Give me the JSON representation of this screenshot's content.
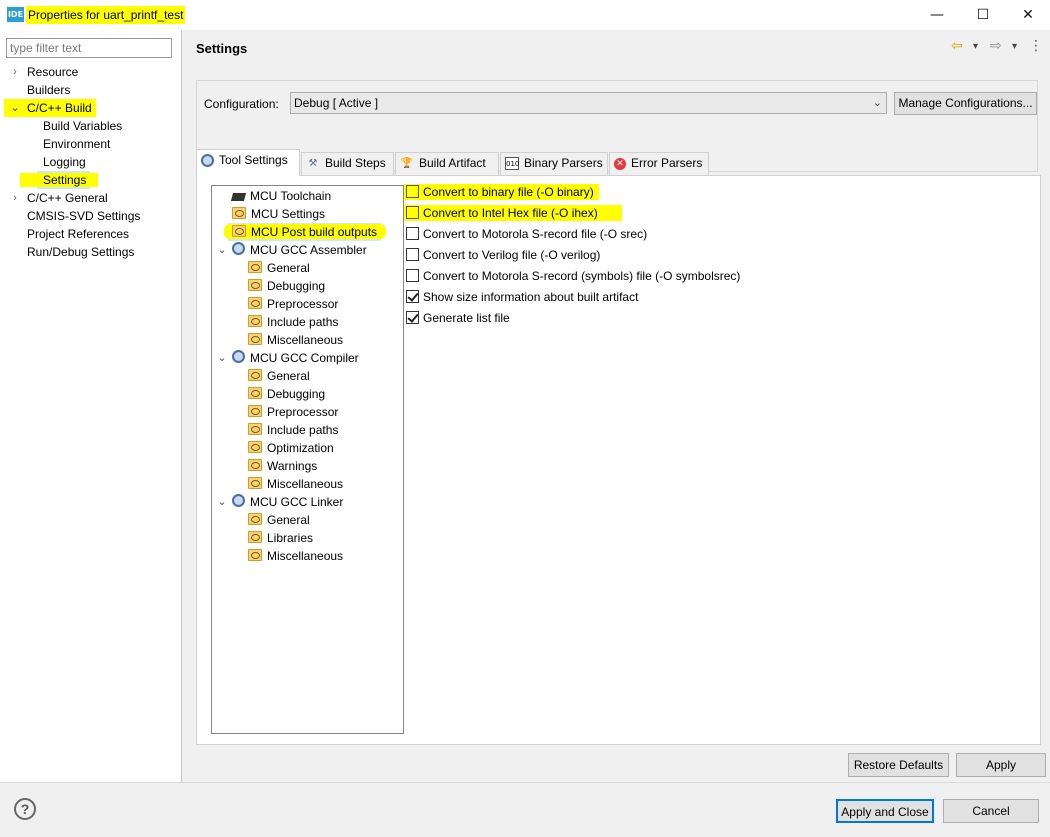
{
  "window": {
    "icon_label": "IDE",
    "title": "Properties for uart_printf_test",
    "minimize_glyph": "—",
    "maximize_glyph": "☐",
    "close_glyph": "✕"
  },
  "sidebar": {
    "filter_placeholder": "type filter text",
    "items": [
      {
        "label": "Resource",
        "arrow": "›"
      },
      {
        "label": "Builders",
        "arrow": ""
      },
      {
        "label": "C/C++ Build",
        "arrow": "⌄"
      },
      {
        "label": "Build Variables",
        "arrow": ""
      },
      {
        "label": "Environment",
        "arrow": ""
      },
      {
        "label": "Logging",
        "arrow": ""
      },
      {
        "label": "Settings",
        "arrow": ""
      },
      {
        "label": "C/C++ General",
        "arrow": "›"
      },
      {
        "label": "CMSIS-SVD Settings",
        "arrow": ""
      },
      {
        "label": "Project References",
        "arrow": ""
      },
      {
        "label": "Run/Debug Settings",
        "arrow": ""
      }
    ]
  },
  "header": {
    "title": "Settings",
    "back_glyph": "⇦",
    "forward_glyph": "⇨",
    "dropdown_glyph": "▾",
    "menu_glyph": "⋮"
  },
  "configuration": {
    "label": "Configuration:",
    "value": "Debug  [ Active ]",
    "manage_button": "Manage Configurations..."
  },
  "tabs": [
    {
      "label": "Tool Settings"
    },
    {
      "label": "Build Steps"
    },
    {
      "label": "Build Artifact"
    },
    {
      "label": "Binary Parsers"
    },
    {
      "label": "Error Parsers"
    }
  ],
  "tree": {
    "items": [
      {
        "label": "MCU Toolchain"
      },
      {
        "label": "MCU Settings"
      },
      {
        "label": "MCU Post build outputs"
      },
      {
        "label": "MCU GCC Assembler"
      },
      {
        "label": "General"
      },
      {
        "label": "Debugging"
      },
      {
        "label": "Preprocessor"
      },
      {
        "label": "Include paths"
      },
      {
        "label": "Miscellaneous"
      },
      {
        "label": "MCU GCC Compiler"
      },
      {
        "label": "General"
      },
      {
        "label": "Debugging"
      },
      {
        "label": "Preprocessor"
      },
      {
        "label": "Include paths"
      },
      {
        "label": "Optimization"
      },
      {
        "label": "Warnings"
      },
      {
        "label": "Miscellaneous"
      },
      {
        "label": "MCU GCC Linker"
      },
      {
        "label": "General"
      },
      {
        "label": "Libraries"
      },
      {
        "label": "Miscellaneous"
      }
    ]
  },
  "options": [
    {
      "label": "Convert to binary file (-O binary)",
      "checked": false
    },
    {
      "label": "Convert to Intel Hex file (-O ihex)",
      "checked": false
    },
    {
      "label": "Convert to Motorola S-record file (-O srec)",
      "checked": false
    },
    {
      "label": "Convert to Verilog file (-O verilog)",
      "checked": false
    },
    {
      "label": "Convert to Motorola S-record (symbols) file (-O symbolsrec)",
      "checked": false
    },
    {
      "label": "Show size information about built artifact",
      "checked": true
    },
    {
      "label": "Generate list file",
      "checked": true
    }
  ],
  "buttons": {
    "restore_defaults": "Restore Defaults",
    "apply": "Apply",
    "apply_and_close": "Apply and Close",
    "cancel": "Cancel",
    "help": "?"
  },
  "colors": {
    "highlight": "#ffff00",
    "selection": "#cce8ff",
    "app_icon": "#2a9fd6"
  }
}
